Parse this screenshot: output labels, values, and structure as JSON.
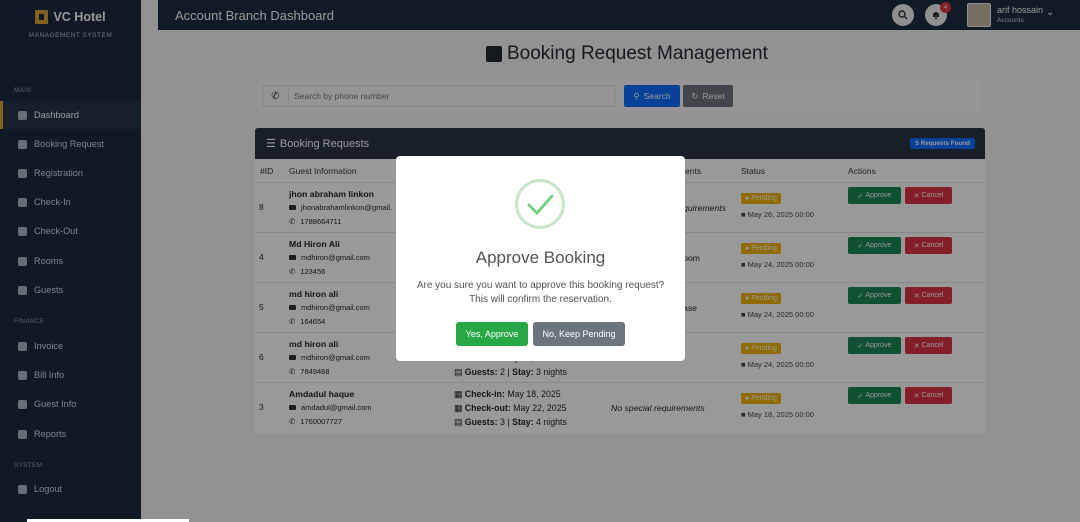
{
  "brand": {
    "name": "VC Hotel",
    "subtitle": "MANAGEMENT SYSTEM"
  },
  "sidebar": {
    "sections": {
      "main": "MAIN",
      "finance": "FINANCE",
      "system": "SYSTEM"
    },
    "items": [
      {
        "label": "Dashboard",
        "icon": "dashboard-icon"
      },
      {
        "label": "Booking Request",
        "icon": "key-icon"
      },
      {
        "label": "Registration",
        "icon": "id-card-icon"
      },
      {
        "label": "Check-In",
        "icon": "sign-in-icon"
      },
      {
        "label": "Check-Out",
        "icon": "sign-out-icon"
      },
      {
        "label": "Rooms",
        "icon": "door-icon"
      },
      {
        "label": "Guests",
        "icon": "users-icon"
      },
      {
        "label": "Invoice",
        "icon": "file-icon"
      },
      {
        "label": "Bill Info",
        "icon": "bill-icon"
      },
      {
        "label": "Guest Info",
        "icon": "users-icon"
      },
      {
        "label": "Reports",
        "icon": "chart-icon"
      },
      {
        "label": "Logout",
        "icon": "logout-icon"
      }
    ]
  },
  "topbar": {
    "title": "Account Branch Dashboard",
    "notif_count": "4",
    "user_name": "arif hossain",
    "user_role": "Accounts"
  },
  "page": {
    "title": "Booking Request Management"
  },
  "search": {
    "placeholder": "Search by phone number",
    "search_label": "Search",
    "reset_label": "Reset"
  },
  "table": {
    "title": "Booking Requests",
    "found_badge": "5 Requests Found",
    "headers": [
      "#ID",
      "Guest Information",
      "ents",
      "Status",
      "Actions"
    ],
    "rows": [
      {
        "id": "8",
        "name": "jhon abraham linkon",
        "email": "jhonabrahamlinkon@gmail.",
        "phone": "1788664711",
        "note": "quirements",
        "status": "Pending",
        "date": "May 26, 2025 00:00"
      },
      {
        "id": "4",
        "name": "Md Hiron Ali",
        "email": "mdhiron@gmail.com",
        "phone": "123456",
        "note": "oom",
        "status": "Pending",
        "date": "May 24, 2025 00:00"
      },
      {
        "id": "5",
        "name": "md hiron ali",
        "email": "mdhiron@gmail.com",
        "phone": "164654",
        "note": "ase",
        "status": "Pending",
        "date": "May 24, 2025 00:00"
      },
      {
        "id": "6",
        "name": "md hiron ali",
        "email": "mdhiron@gmail.com",
        "phone": "7849468",
        "checkin_label": "Check-out:",
        "checkin_value": "May 27, 2025",
        "guests_label": "Guests:",
        "guests_value": "2",
        "stay_label": "Stay:",
        "stay_value": "3 nights",
        "note": "n.",
        "status": "Pending",
        "date": "May 24, 2025 00:00"
      },
      {
        "id": "3",
        "name": "Amdadul haque",
        "email": "amdadul@gmail.com",
        "phone": "1760007727",
        "checkin_label": "Check-in:",
        "checkin_value": "May 18, 2025",
        "checkout_label": "Check-out:",
        "checkout_value": "May 22, 2025",
        "guests_label": "Guests:",
        "guests_value": "3",
        "stay_label": "Stay:",
        "stay_value": "4 nights",
        "note": "No special requirements",
        "status": "Pending",
        "date": "May 18, 2025 00:00"
      }
    ],
    "approve_label": "Approve",
    "cancel_label": "Cancel"
  },
  "modal": {
    "title": "Approve Booking",
    "text_line1": "Are you sure you want to approve this booking request?",
    "text_line2": "This will confirm the reservation.",
    "confirm_label": "Yes, Approve",
    "cancel_label": "No, Keep Pending"
  },
  "colors": {
    "sidebar": "#1c2b3f",
    "accent": "#d9a53a",
    "approve": "#198754",
    "cancel": "#dc3545",
    "pending": "#f0b400",
    "primary": "#0d6efd"
  }
}
